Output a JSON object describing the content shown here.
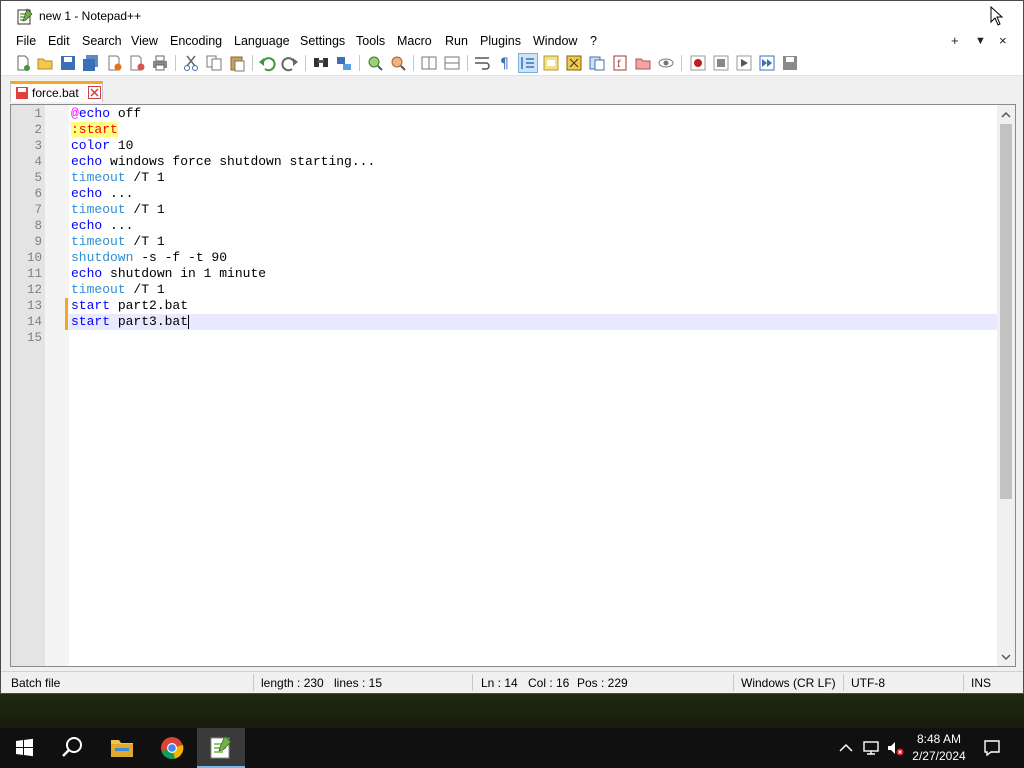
{
  "window": {
    "title": "new 1 - Notepad++"
  },
  "menu": {
    "items": [
      "File",
      "Edit",
      "Search",
      "View",
      "Encoding",
      "Language",
      "Settings",
      "Tools",
      "Macro",
      "Run",
      "Plugins",
      "Window",
      "?"
    ],
    "right": {
      "plus": "+",
      "dropdown": "▼",
      "close": "×"
    }
  },
  "tab": {
    "label": "force.bat"
  },
  "editor": {
    "lines": [
      {
        "num": "1"
      },
      {
        "num": "2"
      },
      {
        "num": "3"
      },
      {
        "num": "4"
      },
      {
        "num": "5"
      },
      {
        "num": "6"
      },
      {
        "num": "7"
      },
      {
        "num": "8"
      },
      {
        "num": "9"
      },
      {
        "num": "10"
      },
      {
        "num": "11"
      },
      {
        "num": "12"
      },
      {
        "num": "13"
      },
      {
        "num": "14"
      },
      {
        "num": "15"
      }
    ],
    "code": {
      "l1_at": "@",
      "l1_kw": "echo",
      "l1_rest": " off",
      "l2_label": ":start",
      "l3_kw": "color",
      "l3_rest": " 10",
      "l4_kw": "echo",
      "l4_rest": " windows force shutdown starting...",
      "l5_kw": "timeout",
      "l5_rest": " /T 1",
      "l6_kw": "echo",
      "l6_rest": " ...",
      "l7_kw": "timeout",
      "l7_rest": " /T 1",
      "l8_kw": "echo",
      "l8_rest": " ...",
      "l9_kw": "timeout",
      "l9_rest": " /T 1",
      "l10_kw": "shutdown",
      "l10_rest": " -s -f -t 90",
      "l11_kw": "echo",
      "l11_rest": " shutdown in 1 minute",
      "l12_kw": "timeout",
      "l12_rest": " /T 1",
      "l13_kw": "start",
      "l13_rest": " part2.bat",
      "l14_kw": "start",
      "l14_rest": " part3.bat"
    }
  },
  "status": {
    "filetype": "Batch file",
    "length": "length : 230",
    "lines": "lines : 15",
    "ln": "Ln : 14",
    "col": "Col : 16",
    "pos": "Pos : 229",
    "eol": "Windows (CR LF)",
    "encoding": "UTF-8",
    "mode": "INS"
  },
  "clock": {
    "time": "8:48 AM",
    "date": "2/27/2024"
  },
  "colors": {
    "keyword": "#0000ff",
    "command": "#2f8fd3",
    "label_bg": "#ffff80",
    "label_fg": "#ff0000",
    "tab_accent": "#f5a623",
    "current_line": "#e8e8ff"
  }
}
